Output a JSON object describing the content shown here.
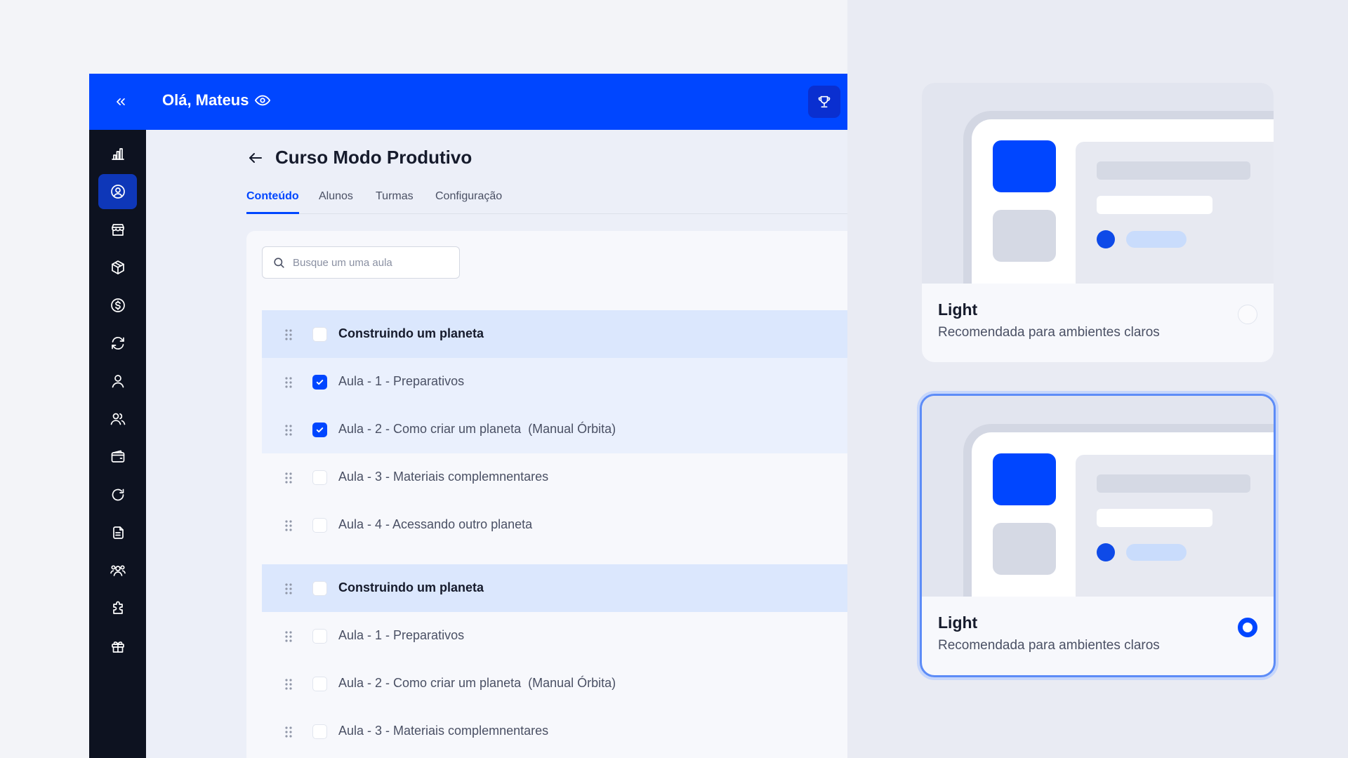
{
  "topbar": {
    "greeting": "Olá, Mateus"
  },
  "icons": {
    "collapse": "double-chevron-left-icon",
    "visibility": "eye-icon",
    "trophy": "trophy-icon",
    "back": "arrow-left-icon",
    "search": "search-icon",
    "drag": "drag-handle-icon"
  },
  "sidebar": {
    "items": [
      {
        "icon": "bar-chart-icon",
        "active": false
      },
      {
        "icon": "user-circle-icon",
        "active": true
      },
      {
        "icon": "store-icon",
        "active": false
      },
      {
        "icon": "box-icon",
        "active": false
      },
      {
        "icon": "dollar-circle-icon",
        "active": false
      },
      {
        "icon": "refresh-icon",
        "active": false
      },
      {
        "icon": "user-icon",
        "active": false
      },
      {
        "icon": "users-icon",
        "active": false
      },
      {
        "icon": "wallet-icon",
        "active": false
      },
      {
        "icon": "rotate-icon",
        "active": false
      },
      {
        "icon": "documents-icon",
        "active": false
      },
      {
        "icon": "community-icon",
        "active": false
      },
      {
        "icon": "puzzle-icon",
        "active": false
      },
      {
        "icon": "gift-icon",
        "active": false
      }
    ]
  },
  "page": {
    "title": "Curso Modo Produtivo"
  },
  "tabs": [
    {
      "label": "Conteúdo",
      "active": true
    },
    {
      "label": "Alunos",
      "active": false
    },
    {
      "label": "Turmas",
      "active": false
    },
    {
      "label": "Configuração",
      "active": false
    }
  ],
  "search": {
    "placeholder": "Busque um uma aula",
    "value": ""
  },
  "rows": [
    {
      "label": "Construindo um planeta",
      "type": "group",
      "checked": false
    },
    {
      "label": "Aula - 1 - Preparativos",
      "type": "lesson",
      "checked": true
    },
    {
      "label": "Aula - 2 - Como criar um planeta  (Manual Órbita)",
      "type": "lesson",
      "checked": true
    },
    {
      "label": "Aula - 3 - Materiais complemnentares",
      "type": "lesson",
      "checked": false
    },
    {
      "label": "Aula - 4 - Acessando outro planeta",
      "type": "lesson",
      "checked": false
    },
    {
      "label": "Construindo um planeta",
      "type": "group",
      "checked": false
    },
    {
      "label": "Aula - 1 - Preparativos",
      "type": "lesson",
      "checked": false
    },
    {
      "label": "Aula - 2 - Como criar um planeta  (Manual Órbita)",
      "type": "lesson",
      "checked": false
    },
    {
      "label": "Aula - 3 - Materiais complemnentares",
      "type": "lesson",
      "checked": false
    }
  ],
  "theme_cards": [
    {
      "title": "Light",
      "subtitle": "Recomendada para ambientes claros",
      "selected": false
    },
    {
      "title": "Light",
      "subtitle": "Recomendada para ambientes claros",
      "selected": true
    }
  ],
  "colors": {
    "brand": "#0046ff",
    "sidebar": "#0d1220",
    "sidebar_active": "#0e37b8",
    "group_row": "#dbe7fd",
    "selected_row": "#eaf0fd"
  }
}
